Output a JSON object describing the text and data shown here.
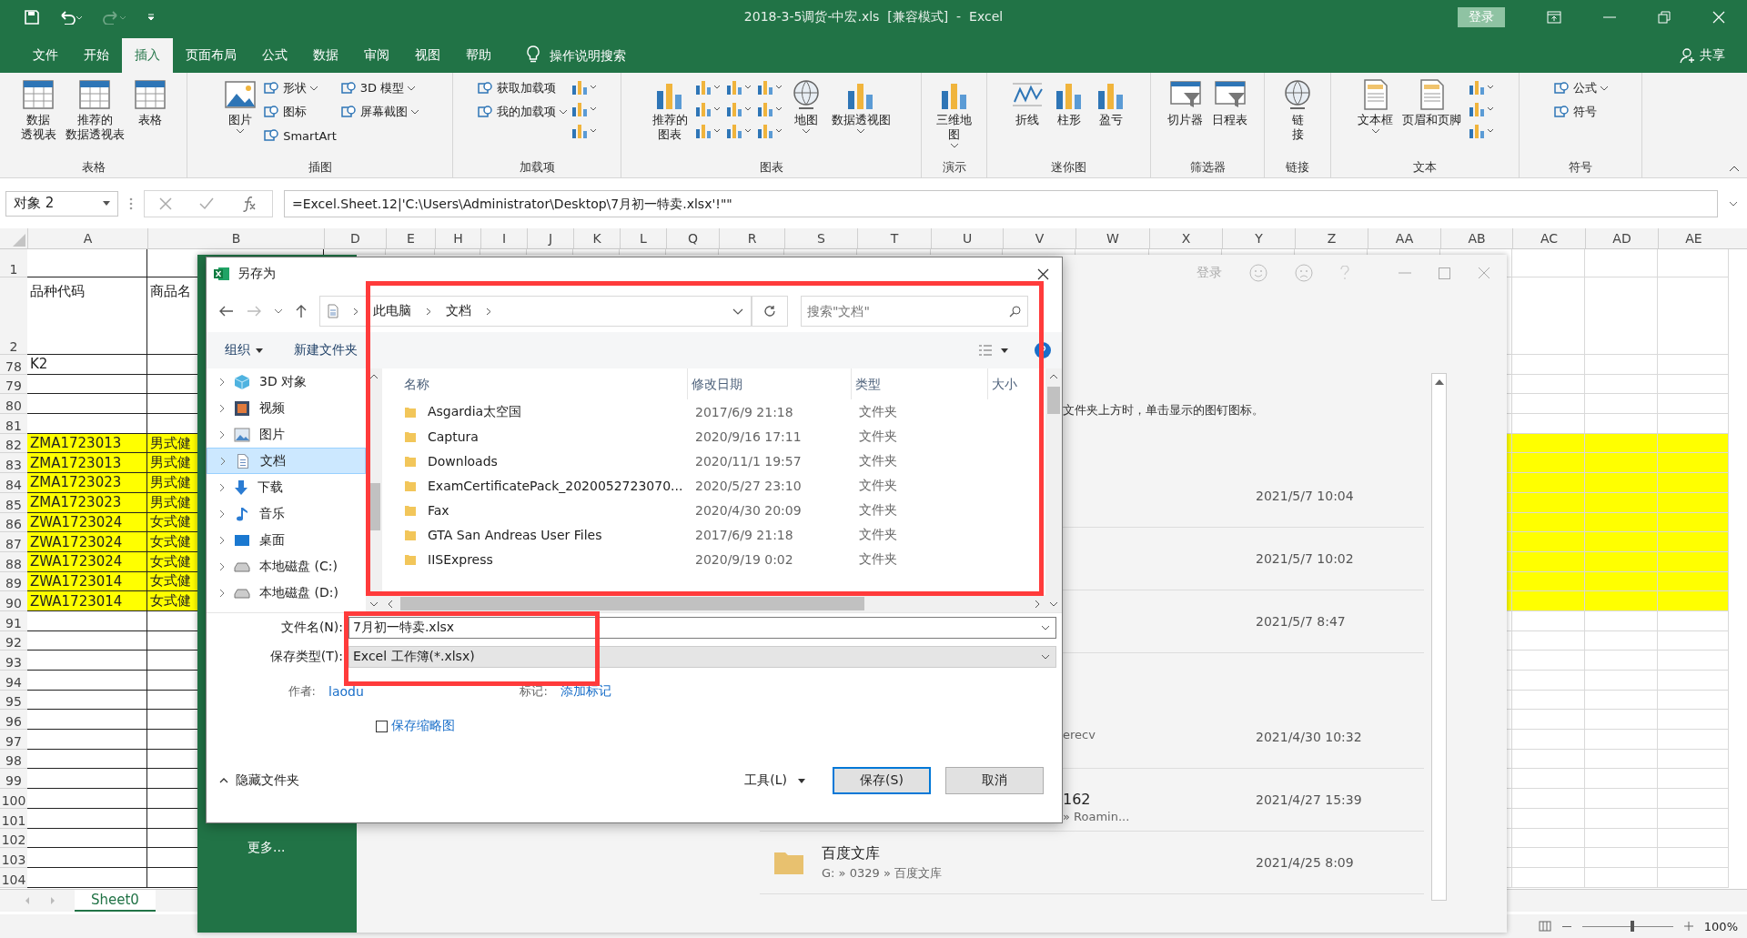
{
  "title_bar": {
    "title": "2018-3-5调货-中宏.xls  [兼容模式]  -  Excel",
    "signin": "登录"
  },
  "tabs": [
    {
      "label": "文件",
      "selected": false
    },
    {
      "label": "开始",
      "selected": false
    },
    {
      "label": "插入",
      "selected": true
    },
    {
      "label": "页面布局",
      "selected": false
    },
    {
      "label": "公式",
      "selected": false
    },
    {
      "label": "数据",
      "selected": false
    },
    {
      "label": "审阅",
      "selected": false
    },
    {
      "label": "视图",
      "selected": false
    },
    {
      "label": "帮助",
      "selected": false
    }
  ],
  "tell_me": "操作说明搜索",
  "share": "共享",
  "ribbon": [
    {
      "label": "表格",
      "items": [
        {
          "kind": "large",
          "lines": [
            "数据",
            "透视表"
          ],
          "dropdown": false
        },
        {
          "kind": "large",
          "lines": [
            "推荐的",
            "数据透视表"
          ],
          "dropdown": false
        },
        {
          "kind": "large",
          "lines": [
            "表格"
          ],
          "dropdown": false
        }
      ]
    },
    {
      "label": "插图",
      "items": [
        {
          "kind": "large",
          "lines": [
            "图片"
          ],
          "dropdown": true
        },
        {
          "kind": "stack",
          "entries": [
            {
              "label": "形状",
              "dropdown": true
            },
            {
              "label": "图标",
              "dropdown": false
            },
            {
              "label": "SmartArt",
              "dropdown": false
            }
          ]
        },
        {
          "kind": "stack",
          "entries": [
            {
              "label": "3D 模型",
              "dropdown": true
            },
            {
              "label": "屏幕截图",
              "dropdown": true
            }
          ]
        }
      ]
    },
    {
      "label": "加载项",
      "items": [
        {
          "kind": "stack",
          "entries": [
            {
              "label": "获取加载项",
              "dropdown": false
            },
            {
              "label": "我的加载项",
              "dropdown": true
            }
          ]
        },
        {
          "kind": "icons"
        }
      ]
    },
    {
      "label": "图表",
      "items": [
        {
          "kind": "large",
          "lines": [
            "推荐的",
            "图表"
          ],
          "dropdown": false
        },
        {
          "kind": "icons"
        },
        {
          "kind": "icons"
        },
        {
          "kind": "icons"
        },
        {
          "kind": "large",
          "lines": [
            "地图"
          ],
          "dropdown": true
        },
        {
          "kind": "large",
          "lines": [
            "数据透视图"
          ],
          "dropdown": true
        }
      ]
    },
    {
      "label": "演示",
      "items": [
        {
          "kind": "large",
          "lines": [
            "三维地",
            "图"
          ],
          "dropdown": true
        }
      ]
    },
    {
      "label": "迷你图",
      "items": [
        {
          "kind": "large",
          "lines": [
            "折线"
          ],
          "dropdown": false
        },
        {
          "kind": "large",
          "lines": [
            "柱形"
          ],
          "dropdown": false
        },
        {
          "kind": "large",
          "lines": [
            "盈亏"
          ],
          "dropdown": false
        }
      ]
    },
    {
      "label": "筛选器",
      "items": [
        {
          "kind": "large",
          "lines": [
            "切片器"
          ],
          "dropdown": false
        },
        {
          "kind": "large",
          "lines": [
            "日程表"
          ],
          "dropdown": false
        }
      ]
    },
    {
      "label": "链接",
      "items": [
        {
          "kind": "large",
          "lines": [
            "链",
            "接"
          ],
          "dropdown": false
        }
      ]
    },
    {
      "label": "文本",
      "items": [
        {
          "kind": "large",
          "lines": [
            "文本框"
          ],
          "dropdown": true
        },
        {
          "kind": "large",
          "lines": [
            "页眉和页脚"
          ],
          "dropdown": false
        },
        {
          "kind": "icons"
        }
      ]
    },
    {
      "label": "符号",
      "items": [
        {
          "kind": "stack",
          "entries": [
            {
              "label": "公式",
              "dropdown": true
            },
            {
              "label": "符号",
              "dropdown": false
            }
          ]
        }
      ]
    }
  ],
  "formula_bar": {
    "name_box": "对象 2",
    "formula": "=Excel.Sheet.12|'C:\\Users\\Administrator\\Desktop\\7月初一特卖.xlsx'!\"\""
  },
  "sheet": {
    "columns": [
      "A",
      "B",
      "D",
      "E",
      "H",
      "I",
      "J",
      "K",
      "L",
      "Q",
      "R",
      "S",
      "T",
      "U",
      "V",
      "W",
      "X",
      "Y",
      "Z",
      "AA",
      "AB",
      "AC",
      "AD",
      "AE"
    ],
    "rows": [
      {
        "label": "1",
        "highlight": false
      },
      {
        "label": "2",
        "a": "品种代码",
        "b": "商品名",
        "highlight": false
      },
      {
        "label": "78",
        "a": "K2",
        "highlight": false
      },
      {
        "label": "79",
        "highlight": false
      },
      {
        "label": "80",
        "highlight": false
      },
      {
        "label": "81",
        "highlight": false
      },
      {
        "label": "82",
        "a": "ZMA1723013",
        "b": "男式健",
        "highlight": true
      },
      {
        "label": "83",
        "a": "ZMA1723013",
        "b": "男式健",
        "highlight": true
      },
      {
        "label": "84",
        "a": "ZMA1723023",
        "b": "男式健",
        "highlight": true
      },
      {
        "label": "85",
        "a": "ZMA1723023",
        "b": "男式健",
        "highlight": true
      },
      {
        "label": "86",
        "a": "ZWA1723024",
        "b": "女式健",
        "highlight": true
      },
      {
        "label": "87",
        "a": "ZWA1723024",
        "b": "女式健",
        "highlight": true
      },
      {
        "label": "88",
        "a": "ZWA1723024",
        "b": "女式健",
        "highlight": true
      },
      {
        "label": "89",
        "a": "ZWA1723014",
        "b": "女式健",
        "highlight": true
      },
      {
        "label": "90",
        "a": "ZWA1723014",
        "b": "女式健",
        "highlight": true
      },
      {
        "label": "91",
        "highlight": false
      },
      {
        "label": "92",
        "highlight": false
      },
      {
        "label": "93",
        "highlight": false
      },
      {
        "label": "94",
        "highlight": false
      },
      {
        "label": "95",
        "highlight": false
      },
      {
        "label": "96",
        "highlight": false
      },
      {
        "label": "97",
        "highlight": false
      },
      {
        "label": "98",
        "highlight": false
      },
      {
        "label": "99",
        "highlight": false
      },
      {
        "label": "100",
        "highlight": false
      },
      {
        "label": "101",
        "highlight": false
      },
      {
        "label": "102",
        "highlight": false
      },
      {
        "label": "103",
        "highlight": false
      },
      {
        "label": "104",
        "highlight": false
      }
    ]
  },
  "sheet_tabs": [
    {
      "label": "Sheet0",
      "selected": true
    }
  ],
  "status_bar": {
    "zoom": "100%",
    "level": 0.55
  },
  "backstage": {
    "signin": "登录",
    "hint": "文件夹上方时，单击显示的图钉图标。",
    "more": "更多...",
    "entries": [
      {
        "date": "2021/5/7 10:04"
      },
      {
        "date": "2021/5/7 10:02"
      },
      {
        "date": "2021/5/7 8:47"
      },
      {
        "kind": "partial",
        "path": "erecv",
        "date": "2021/4/30 10:32"
      },
      {
        "kind": "partial",
        "name": "162",
        "path": "» Roamin...",
        "date": "2021/4/27 15:39"
      },
      {
        "kind": "folder",
        "name": "百度文库",
        "path": "G: » 0329 » 百度文库",
        "date": "2021/4/25 8:09"
      }
    ]
  },
  "dialog": {
    "title": "另存为",
    "path": [
      "此电脑",
      "文档"
    ],
    "search_placeholder": "搜索\"文档\"",
    "toolbar": [
      "组织",
      "新建文件夹"
    ],
    "tree": [
      {
        "label": "3D 对象",
        "selected": false
      },
      {
        "label": "视频",
        "selected": false
      },
      {
        "label": "图片",
        "selected": false
      },
      {
        "label": "文档",
        "selected": true
      },
      {
        "label": "下载",
        "selected": false
      },
      {
        "label": "音乐",
        "selected": false
      },
      {
        "label": "桌面",
        "selected": false
      },
      {
        "label": "本地磁盘 (C:)",
        "selected": false
      },
      {
        "label": "本地磁盘 (D:)",
        "selected": false
      }
    ],
    "columns": [
      "名称",
      "修改日期",
      "类型",
      "大小"
    ],
    "files": [
      {
        "name": "Asgardia太空国",
        "date": "2017/6/9 21:18",
        "type": "文件夹"
      },
      {
        "name": "Captura",
        "date": "2020/9/16 17:11",
        "type": "文件夹"
      },
      {
        "name": "Downloads",
        "date": "2020/11/1 19:57",
        "type": "文件夹"
      },
      {
        "name": "ExamCertificatePack_2020052723070...",
        "date": "2020/5/27 23:10",
        "type": "文件夹"
      },
      {
        "name": "Fax",
        "date": "2020/4/30 20:09",
        "type": "文件夹"
      },
      {
        "name": "GTA San Andreas User Files",
        "date": "2017/6/9 21:18",
        "type": "文件夹"
      },
      {
        "name": "IISExpress",
        "date": "2020/9/19 0:02",
        "type": "文件夹"
      }
    ],
    "file_name_label": "文件名(N):",
    "file_name": "7月初一特卖.xlsx",
    "file_type_label": "保存类型(T):",
    "file_type": "Excel 工作簿(*.xlsx)",
    "author_label": "作者:",
    "author": "laodu",
    "tags_label": "标记:",
    "tags": "添加标记",
    "thumbnail": {
      "label": "保存缩略图",
      "checked": false
    },
    "hide_folders": "隐藏文件夹",
    "tools": "工具(L)",
    "save": "保存(S)",
    "cancel": "取消"
  }
}
